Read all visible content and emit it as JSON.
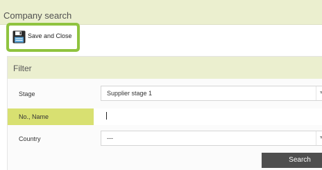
{
  "page": {
    "title": "Company search"
  },
  "toolbar": {
    "save_close_label": "Save and Close",
    "save_icon": "save-disk-icon",
    "highlight_color": "#8fc33f"
  },
  "filter": {
    "title": "Filter",
    "highlight_color": "#d8e071",
    "fields": {
      "stage": {
        "label": "Stage",
        "value": "Supplier stage 1"
      },
      "no_name": {
        "label": "No., Name",
        "value": ""
      },
      "country": {
        "label": "Country",
        "value": "---"
      }
    },
    "dropdown_icon": "triangle-down-icon",
    "search_label": "Search"
  }
}
